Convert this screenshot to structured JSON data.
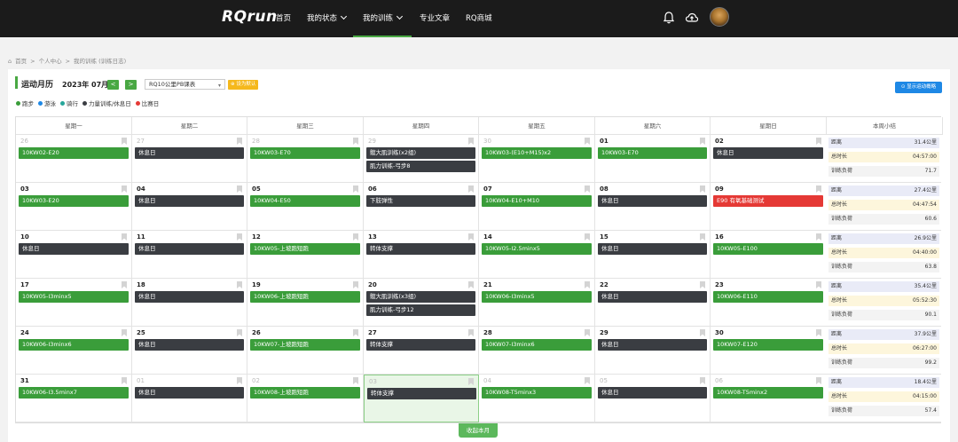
{
  "nav": {
    "logo": "RQrun",
    "items": [
      {
        "label": "首页",
        "has_dropdown": false
      },
      {
        "label": "我的状态",
        "has_dropdown": true
      },
      {
        "label": "我的训练",
        "has_dropdown": true,
        "active": true
      },
      {
        "label": "专业文章",
        "has_dropdown": false
      },
      {
        "label": "RQ商城",
        "has_dropdown": false
      }
    ],
    "icons": [
      "bell-icon",
      "cloud-upload-icon",
      "avatar"
    ]
  },
  "breadcrumb": [
    "首页",
    ">",
    "个人中心",
    ">",
    "我的训练 (训练日志)"
  ],
  "calendar": {
    "title": "运动月历",
    "month": "2023年 07月",
    "prev": "<",
    "next": ">",
    "plan": "RQ10公里PB课表",
    "set_default": "设为默认",
    "show_button": "显示运动概略",
    "legend": [
      {
        "label": "跑步",
        "color": "#3a9d3a"
      },
      {
        "label": "游泳",
        "color": "#1e88e5"
      },
      {
        "label": "骑行",
        "color": "#26a69a"
      },
      {
        "label": "力量训练/休息日",
        "color": "#3a3d42"
      },
      {
        "label": "比赛日",
        "color": "#e53935"
      }
    ],
    "weekdays": [
      "星期一",
      "星期二",
      "星期三",
      "星期四",
      "星期五",
      "星期六",
      "星期日",
      "本周小结"
    ],
    "weeks": [
      {
        "days": [
          {
            "num": "26",
            "dim": true,
            "events": [
              {
                "label": "10KW02-E20",
                "type": "green"
              }
            ]
          },
          {
            "num": "27",
            "dim": true,
            "events": [
              {
                "label": "休息日",
                "type": "dark"
              }
            ]
          },
          {
            "num": "28",
            "dim": true,
            "events": [
              {
                "label": "10KW03-E70",
                "type": "green"
              }
            ]
          },
          {
            "num": "29",
            "dim": true,
            "events": [
              {
                "label": "髋大肌训练(x2组)",
                "type": "dark"
              },
              {
                "label": "肌力训练-弓步8",
                "type": "dark"
              }
            ]
          },
          {
            "num": "30",
            "dim": true,
            "events": [
              {
                "label": "10KW03-(E10+M15)x2",
                "type": "green"
              }
            ]
          },
          {
            "num": "01",
            "dim": false,
            "events": [
              {
                "label": "10KW03-E70",
                "type": "green"
              }
            ]
          },
          {
            "num": "02",
            "dim": false,
            "events": [
              {
                "label": "休息日",
                "type": "dark"
              }
            ]
          }
        ],
        "summary": {
          "distance_label": "距离",
          "distance": "31.4公里",
          "time_label": "总时长",
          "time": "04:57:00",
          "load_label": "训练负荷",
          "load": "71.7"
        }
      },
      {
        "days": [
          {
            "num": "03",
            "dim": false,
            "events": [
              {
                "label": "10KW03-E20",
                "type": "green"
              }
            ]
          },
          {
            "num": "04",
            "dim": false,
            "events": [
              {
                "label": "休息日",
                "type": "dark"
              }
            ]
          },
          {
            "num": "05",
            "dim": false,
            "events": [
              {
                "label": "10KW04-E50",
                "type": "green"
              }
            ]
          },
          {
            "num": "06",
            "dim": false,
            "events": [
              {
                "label": "下肢弹性",
                "type": "dark"
              }
            ]
          },
          {
            "num": "07",
            "dim": false,
            "events": [
              {
                "label": "10KW04-E10+M10",
                "type": "green"
              }
            ]
          },
          {
            "num": "08",
            "dim": false,
            "events": [
              {
                "label": "休息日",
                "type": "dark"
              }
            ]
          },
          {
            "num": "09",
            "dim": false,
            "events": [
              {
                "label": "E90 有氧基础测试",
                "type": "red"
              }
            ]
          }
        ],
        "summary": {
          "distance_label": "距离",
          "distance": "27.4公里",
          "time_label": "总时长",
          "time": "04:47:54",
          "load_label": "训练负荷",
          "load": "60.6"
        }
      },
      {
        "days": [
          {
            "num": "10",
            "dim": false,
            "events": [
              {
                "label": "休息日",
                "type": "dark"
              }
            ]
          },
          {
            "num": "11",
            "dim": false,
            "events": [
              {
                "label": "休息日",
                "type": "dark"
              }
            ]
          },
          {
            "num": "12",
            "dim": false,
            "events": [
              {
                "label": "10KW05-上坡跑短跑",
                "type": "green"
              }
            ]
          },
          {
            "num": "13",
            "dim": false,
            "events": [
              {
                "label": "转体支撑",
                "type": "dark"
              }
            ]
          },
          {
            "num": "14",
            "dim": false,
            "events": [
              {
                "label": "10KW05-I2.5minx5",
                "type": "green"
              }
            ]
          },
          {
            "num": "15",
            "dim": false,
            "events": [
              {
                "label": "休息日",
                "type": "dark"
              }
            ]
          },
          {
            "num": "16",
            "dim": false,
            "events": [
              {
                "label": "10KW05-E100",
                "type": "green"
              }
            ]
          }
        ],
        "summary": {
          "distance_label": "距离",
          "distance": "26.9公里",
          "time_label": "总时长",
          "time": "04:40:00",
          "load_label": "训练负荷",
          "load": "63.8"
        }
      },
      {
        "days": [
          {
            "num": "17",
            "dim": false,
            "events": [
              {
                "label": "10KW05-I3minx5",
                "type": "green"
              }
            ]
          },
          {
            "num": "18",
            "dim": false,
            "events": [
              {
                "label": "休息日",
                "type": "dark"
              }
            ]
          },
          {
            "num": "19",
            "dim": false,
            "events": [
              {
                "label": "10KW06-上坡跑短跑",
                "type": "green"
              }
            ]
          },
          {
            "num": "20",
            "dim": false,
            "events": [
              {
                "label": "髋大肌训练(x3组)",
                "type": "dark"
              },
              {
                "label": "肌力训练-弓步12",
                "type": "dark"
              }
            ]
          },
          {
            "num": "21",
            "dim": false,
            "events": [
              {
                "label": "10KW06-I3minx5",
                "type": "green"
              }
            ]
          },
          {
            "num": "22",
            "dim": false,
            "events": [
              {
                "label": "休息日",
                "type": "dark"
              }
            ]
          },
          {
            "num": "23",
            "dim": false,
            "events": [
              {
                "label": "10KW06-E110",
                "type": "green"
              }
            ]
          }
        ],
        "summary": {
          "distance_label": "距离",
          "distance": "35.4公里",
          "time_label": "总时长",
          "time": "05:52:30",
          "load_label": "训练负荷",
          "load": "90.1"
        }
      },
      {
        "days": [
          {
            "num": "24",
            "dim": false,
            "events": [
              {
                "label": "10KW06-I3minx6",
                "type": "green"
              }
            ]
          },
          {
            "num": "25",
            "dim": false,
            "events": [
              {
                "label": "休息日",
                "type": "dark"
              }
            ]
          },
          {
            "num": "26",
            "dim": false,
            "events": [
              {
                "label": "10KW07-上坡跑短跑",
                "type": "green"
              }
            ]
          },
          {
            "num": "27",
            "dim": false,
            "events": [
              {
                "label": "转体支撑",
                "type": "dark"
              }
            ]
          },
          {
            "num": "28",
            "dim": false,
            "events": [
              {
                "label": "10KW07-I3minx6",
                "type": "green"
              }
            ]
          },
          {
            "num": "29",
            "dim": false,
            "events": [
              {
                "label": "休息日",
                "type": "dark"
              }
            ]
          },
          {
            "num": "30",
            "dim": false,
            "events": [
              {
                "label": "10KW07-E120",
                "type": "green"
              }
            ]
          }
        ],
        "summary": {
          "distance_label": "距离",
          "distance": "37.9公里",
          "time_label": "总时长",
          "time": "06:27:00",
          "load_label": "训练负荷",
          "load": "99.2"
        }
      },
      {
        "days": [
          {
            "num": "31",
            "dim": false,
            "events": [
              {
                "label": "10KW06-I3.5minx7",
                "type": "green"
              }
            ]
          },
          {
            "num": "01",
            "dim": true,
            "events": [
              {
                "label": "休息日",
                "type": "dark"
              }
            ]
          },
          {
            "num": "02",
            "dim": true,
            "events": [
              {
                "label": "10KW08-上坡跑短跑",
                "type": "green"
              }
            ]
          },
          {
            "num": "03",
            "dim": true,
            "today": true,
            "events": [
              {
                "label": "转体支撑",
                "type": "dark"
              }
            ]
          },
          {
            "num": "04",
            "dim": true,
            "events": [
              {
                "label": "10KW08-T5minx3",
                "type": "green"
              }
            ]
          },
          {
            "num": "05",
            "dim": true,
            "events": [
              {
                "label": "休息日",
                "type": "dark"
              }
            ]
          },
          {
            "num": "06",
            "dim": true,
            "events": [
              {
                "label": "10KW08-T5minx2",
                "type": "green"
              }
            ]
          }
        ],
        "summary": {
          "distance_label": "距离",
          "distance": "18.4公里",
          "time_label": "总时长",
          "time": "04:15:00",
          "load_label": "训练负荷",
          "load": "57.4"
        }
      }
    ],
    "collapse": "收起本月"
  }
}
